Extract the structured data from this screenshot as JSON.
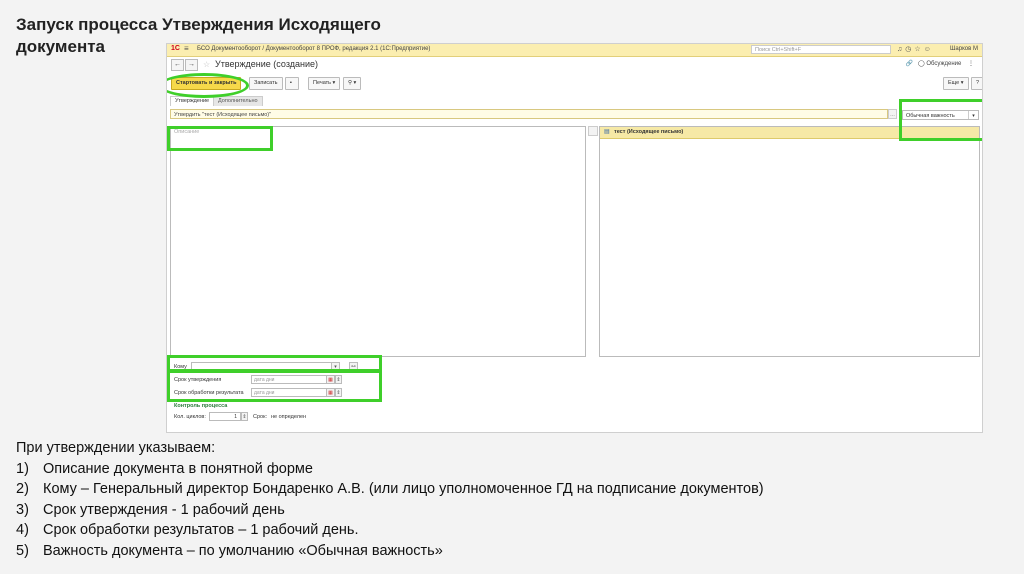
{
  "slide": {
    "title": "Запуск процесса Утверждения Исходящего документа"
  },
  "app": {
    "logo": "1С",
    "title": "БСО Документооборот / Документооборот 8 ПРОФ, редакция 2.1   (1С:Предприятие)",
    "search_placeholder": "Поиск Ctrl+Shift+F",
    "user": "Шарков М"
  },
  "form": {
    "title": "Утверждение (создание)",
    "discussion_label": "Обсуждение",
    "toolbar": {
      "start_close": "Стартовать и закрыть",
      "save": "Записать",
      "print": "Печать",
      "attach": "",
      "more": "Еще",
      "help": "?"
    },
    "tabs": [
      {
        "label": "Утверждение"
      },
      {
        "label": "Дополнительно"
      }
    ],
    "subject": "Утвердить \"тест (Исходящее письмо)\"",
    "importance": "Обычная важность",
    "description_placeholder": "Описание",
    "attachment": "тест (Исходящее письмо)",
    "to_label": "Кому",
    "approval_deadline_label": "Срок утверждения",
    "processing_deadline_label": "Срок обработки результата",
    "date_placeholder": "дата  дни",
    "process_control_label": "Контроль процесса",
    "cycles_label": "Кол. циклов:",
    "cycles_value": "1",
    "term_label": "Срок:",
    "term_value": "не определен"
  },
  "notes": {
    "intro": "При утверждении указываем:",
    "items": [
      {
        "num": "1)",
        "text": "Описание документа в понятной форме"
      },
      {
        "num": "2)",
        "text": "Кому – Генеральный директор Бондаренко А.В. (или лицо уполномоченное ГД на подписание документов)"
      },
      {
        "num": "3)",
        "text": "Срок утверждения  - 1 рабочий день"
      },
      {
        "num": "4)",
        "text": "Срок обработки результатов – 1 рабочий день."
      },
      {
        "num": "5)",
        "text": "Важность документа – по умолчанию «Обычная важность»"
      }
    ]
  },
  "colors": {
    "highlight": "#3fcf2a",
    "accent_yellow": "#f6d94a",
    "topbar": "#fbeeb0"
  }
}
